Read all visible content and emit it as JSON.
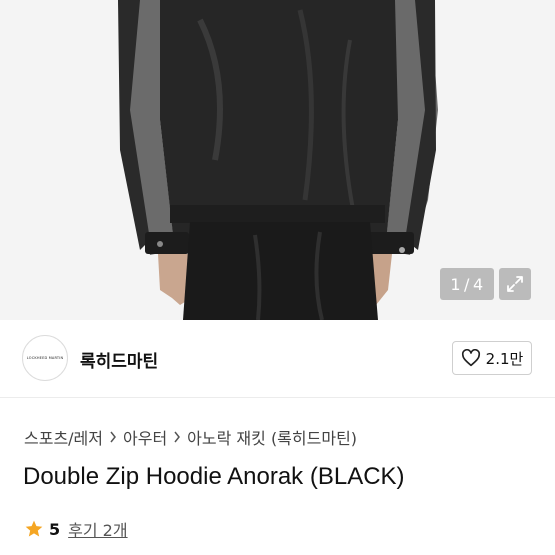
{
  "gallery": {
    "current": "1",
    "separator": "/",
    "total": "4",
    "expand_icon": "expand-arrows-icon"
  },
  "shop": {
    "logo_text": "LOCKHEED MARTIN",
    "name": "록히드마틴",
    "like_icon": "heart-outline-icon",
    "like_count": "2.1만"
  },
  "breadcrumb": {
    "items": [
      "스포츠/레저",
      "아우터",
      "아노락 재킷 (록히드마틴)"
    ],
    "separator_icon": "chevron-right-icon"
  },
  "product": {
    "title": "Double Zip Hoodie Anorak (BLACK)",
    "rating_icon": "star-icon",
    "rating": "5",
    "review_label": "후기 2개"
  },
  "colors": {
    "star": "#f5a623",
    "jacket": "#232323",
    "sleeve": "#6b6b6b"
  }
}
